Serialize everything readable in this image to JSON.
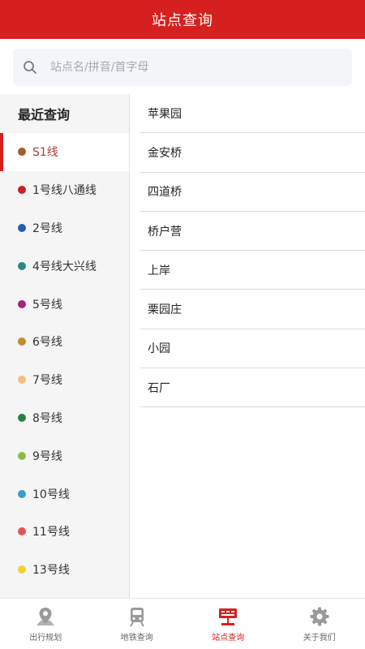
{
  "header": {
    "title": "站点查询"
  },
  "search": {
    "placeholder": "站点名/拼音/首字母"
  },
  "sidebar": {
    "heading": "最近查询",
    "items": [
      {
        "label": "S1线",
        "color": "#a85b2a",
        "active": true
      },
      {
        "label": "1号线八通线",
        "color": "#c52424",
        "active": false
      },
      {
        "label": "2号线",
        "color": "#1f5fab",
        "active": false
      },
      {
        "label": "4号线大兴线",
        "color": "#2a8a86",
        "active": false
      },
      {
        "label": "5号线",
        "color": "#a3247f",
        "active": false
      },
      {
        "label": "6号线",
        "color": "#c28d2f",
        "active": false
      },
      {
        "label": "7号线",
        "color": "#f0c07a",
        "active": false
      },
      {
        "label": "8号线",
        "color": "#2d8140",
        "active": false
      },
      {
        "label": "9号线",
        "color": "#8dbb45",
        "active": false
      },
      {
        "label": "10号线",
        "color": "#3d9ec9",
        "active": false
      },
      {
        "label": "11号线",
        "color": "#e05454",
        "active": false
      },
      {
        "label": "13号线",
        "color": "#f2d233",
        "active": false
      }
    ]
  },
  "stations": [
    "苹果园",
    "金安桥",
    "四道桥",
    "桥户营",
    "上岸",
    "栗园庄",
    "小园",
    "石厂"
  ],
  "tabs": [
    {
      "label": "出行规划",
      "icon": "map-pin-icon",
      "active": false
    },
    {
      "label": "地铁查询",
      "icon": "train-icon",
      "active": false
    },
    {
      "label": "站点查询",
      "icon": "station-sign-icon",
      "active": true
    },
    {
      "label": "关于我们",
      "icon": "gear-icon",
      "active": false
    }
  ],
  "colors": {
    "brand": "#d6201f",
    "inactive_icon": "#9a9a9a"
  }
}
